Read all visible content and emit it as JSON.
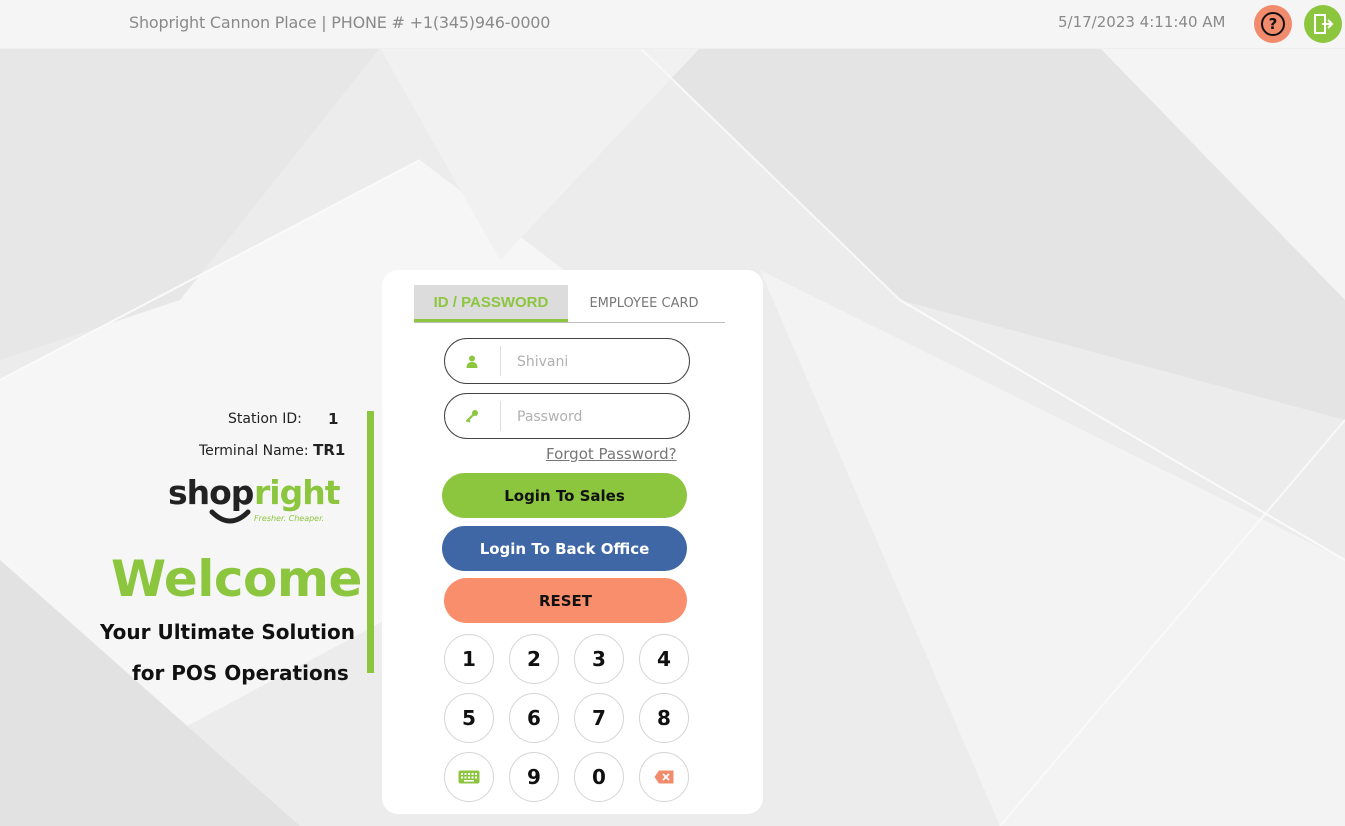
{
  "header": {
    "store_info": "Shopright Cannon Place | PHONE # +1(345)946-0000",
    "datetime": "5/17/2023 4:11:40 AM",
    "help_icon": "question-circle-icon",
    "logout_icon": "logout-door-icon"
  },
  "info": {
    "station_label": "Station ID:",
    "station_value": "1",
    "terminal_label": "Terminal Name:",
    "terminal_value": "TR1",
    "logo_text_a": "shop",
    "logo_text_b": "right",
    "logo_tagline": "Fresher. Cheaper.",
    "welcome": "Welcome",
    "tagline_line1": "Your Ultimate Solution",
    "tagline_line2": "for POS Operations"
  },
  "login": {
    "tab_active": "ID / PASSWORD",
    "tab_inactive": "EMPLOYEE CARD",
    "username_placeholder": "Shivani",
    "password_placeholder": "Password",
    "forgot": "Forgot Password?",
    "btn_sales": "Login To Sales",
    "btn_back_office": "Login To Back Office",
    "btn_reset": "RESET"
  },
  "keypad": {
    "k1": "1",
    "k2": "2",
    "k3": "3",
    "k4": "4",
    "k5": "5",
    "k6": "6",
    "k7": "7",
    "k8": "8",
    "k9": "9",
    "k0": "0",
    "keyboard_icon": "keyboard-icon",
    "backspace_icon": "backspace-icon"
  },
  "colors": {
    "accent_green": "#8cc63f",
    "blue": "#3f67a6",
    "salmon": "#f98e6c"
  }
}
